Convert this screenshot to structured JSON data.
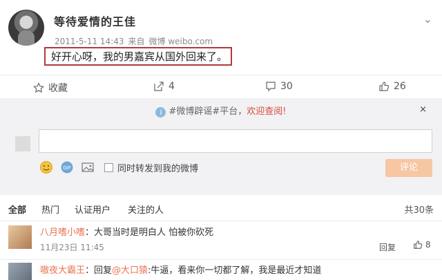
{
  "post": {
    "username": "等待爱情的王佳",
    "date": "2011-5-11 14:43",
    "source_prefix": "来自",
    "source": "微博 weibo.com",
    "content": "好开心呀，我的男嘉宾从国外回来了。"
  },
  "actions": {
    "favorite": "收藏",
    "forward_count": "4",
    "comment_count": "30",
    "like_count": "26"
  },
  "banner": {
    "topic": "#微博辟谣#平台，",
    "link": "欢迎查阅!",
    "close": "×"
  },
  "composer": {
    "input_value": "",
    "forward_checkbox_label": "同时转发到我的微博",
    "submit_label": "评论"
  },
  "filters": {
    "all": "全部",
    "hot": "热门",
    "verified": "认证用户",
    "following": "关注的人",
    "total": "共30条"
  },
  "comments": [
    {
      "user": "八月嗜小嗜",
      "text": "：大哥当时是明白人 怕被你砍死",
      "time": "11月23日 11:45",
      "reply": "回复",
      "likes": "8"
    },
    {
      "user": "嗷夜大霸王",
      "prefix": "：回复",
      "mention": "@大口猿",
      "text": ":牛逼，看来你一切都了解，我是最近才知道"
    }
  ],
  "colors": {
    "highlight_border": "#b03a3a",
    "link_orange": "#eb7350",
    "submit_disabled": "#f7c6a3"
  }
}
